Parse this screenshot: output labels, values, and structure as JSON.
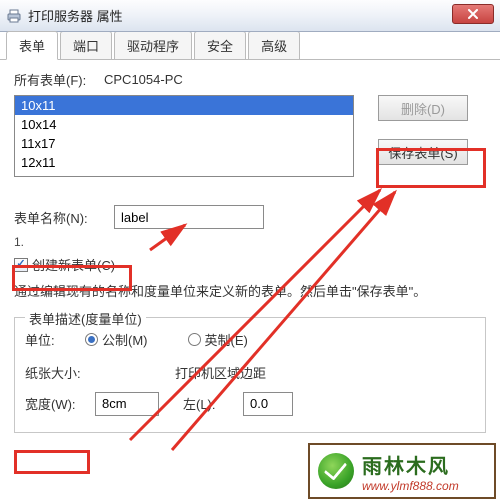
{
  "titlebar": {
    "title": "打印服务器 属性"
  },
  "tabs": [
    {
      "label": "表单",
      "active": true
    },
    {
      "label": "端口",
      "active": false
    },
    {
      "label": "驱动程序",
      "active": false
    },
    {
      "label": "安全",
      "active": false
    },
    {
      "label": "高级",
      "active": false
    }
  ],
  "forms": {
    "allFormsLabel": "所有表单(F):",
    "computerName": "CPC1054-PC",
    "items": [
      "10x11",
      "10x14",
      "11x17",
      "12x11"
    ],
    "selectedIndex": 0,
    "deleteBtn": "删除(D)",
    "saveBtn": "保存表单(S)"
  },
  "formName": {
    "label": "表单名称(N):",
    "value": "label"
  },
  "step": "1.",
  "createNew": {
    "label": "创建新表单(C)",
    "checked": true
  },
  "description": "通过编辑现有的名称和度量单位来定义新的表单。然后单击\"保存表单\"。",
  "group": {
    "legend": "表单描述(度量单位)",
    "unitLabel": "单位:",
    "metric": "公制(M)",
    "imperial": "英制(E)",
    "paperSizeLabel": "纸张大小:",
    "marginLabel": "打印机区域边距",
    "widthLabel": "宽度(W):",
    "widthValue": "8cm",
    "leftLabel": "左(L):",
    "leftValue": "0.0"
  },
  "watermark": {
    "line1": "雨林木风",
    "line2": "www.ylmf888.com"
  },
  "colors": {
    "selection": "#3a74d8",
    "red": "#e23027"
  }
}
